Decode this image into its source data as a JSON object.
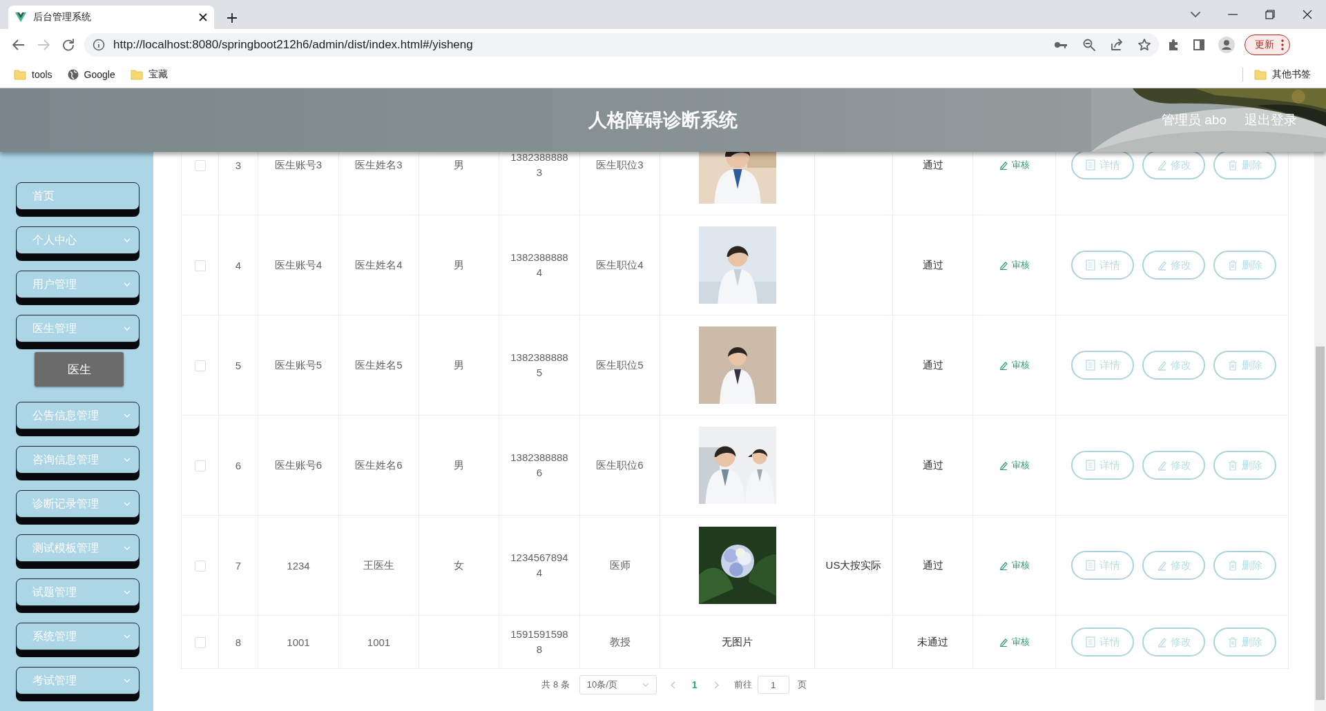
{
  "browser": {
    "tab_title": "后台管理系统",
    "url": "http://localhost:8080/springboot212h6/admin/dist/index.html#/yisheng",
    "bookmarks": [
      {
        "label": "tools",
        "kind": "folder"
      },
      {
        "label": "Google",
        "kind": "site"
      },
      {
        "label": "宝藏",
        "kind": "folder"
      }
    ],
    "other_bookmarks": "其他书签",
    "update_button": "更新"
  },
  "header": {
    "title": "人格障碍诊断系统",
    "user": "管理员 abo",
    "logout": "退出登录"
  },
  "sidebar": {
    "items": [
      {
        "label": "首页",
        "kind": "link"
      },
      {
        "label": "个人中心",
        "kind": "menu"
      },
      {
        "label": "用户管理",
        "kind": "menu"
      },
      {
        "label": "医生管理",
        "kind": "menu",
        "children": [
          {
            "label": "医生",
            "selected": true
          }
        ]
      },
      {
        "label": "公告信息管理",
        "kind": "menu"
      },
      {
        "label": "咨询信息管理",
        "kind": "menu"
      },
      {
        "label": "诊断记录管理",
        "kind": "menu"
      },
      {
        "label": "测试模板管理",
        "kind": "menu"
      },
      {
        "label": "试题管理",
        "kind": "menu"
      },
      {
        "label": "系统管理",
        "kind": "menu"
      },
      {
        "label": "考试管理",
        "kind": "menu"
      }
    ]
  },
  "table": {
    "rows": [
      {
        "checked": false,
        "index": "3",
        "account": "医生账号3",
        "name": "医生姓名3",
        "gender": "男",
        "phone": "13823888883",
        "position": "医生职位3",
        "status": "通过",
        "audit": "审核",
        "actions": [
          "详情",
          "修改",
          "删除"
        ]
      },
      {
        "checked": false,
        "index": "4",
        "account": "医生账号4",
        "name": "医生姓名4",
        "gender": "男",
        "phone": "13823888884",
        "position": "医生职位4",
        "status": "通过",
        "audit": "审核",
        "actions": [
          "详情",
          "修改",
          "删除"
        ]
      },
      {
        "checked": false,
        "index": "5",
        "account": "医生账号5",
        "name": "医生姓名5",
        "gender": "男",
        "phone": "13823888885",
        "position": "医生职位5",
        "status": "通过",
        "audit": "审核",
        "actions": [
          "详情",
          "修改",
          "删除"
        ]
      },
      {
        "checked": false,
        "index": "6",
        "account": "医生账号6",
        "name": "医生姓名6",
        "gender": "男",
        "phone": "13823888886",
        "position": "医生职位6",
        "status": "通过",
        "audit": "审核",
        "actions": [
          "详情",
          "修改",
          "删除"
        ]
      },
      {
        "checked": false,
        "index": "7",
        "account": "1234",
        "name": "王医生",
        "gender": "女",
        "phone": "12345678944",
        "position": "医师",
        "column_9": "US大按实际",
        "status": "通过",
        "audit": "审核",
        "actions": [
          "详情",
          "修改",
          "删除"
        ]
      },
      {
        "checked": false,
        "index": "8",
        "account": "1001",
        "name": "1001",
        "phone": "15915915988",
        "position": "教授",
        "photo": {
          "kind": "text",
          "text": "无图片"
        },
        "status": "未通过",
        "audit": "审核",
        "actions": [
          "详情",
          "修改",
          "删除"
        ]
      }
    ]
  },
  "pagination": {
    "total": "共 8 条",
    "page_size": "10条/页",
    "pages": [
      {
        "label": "1",
        "selected": true
      }
    ],
    "goto_label": "前往",
    "goto_value": "1",
    "goto_suffix": "页"
  }
}
